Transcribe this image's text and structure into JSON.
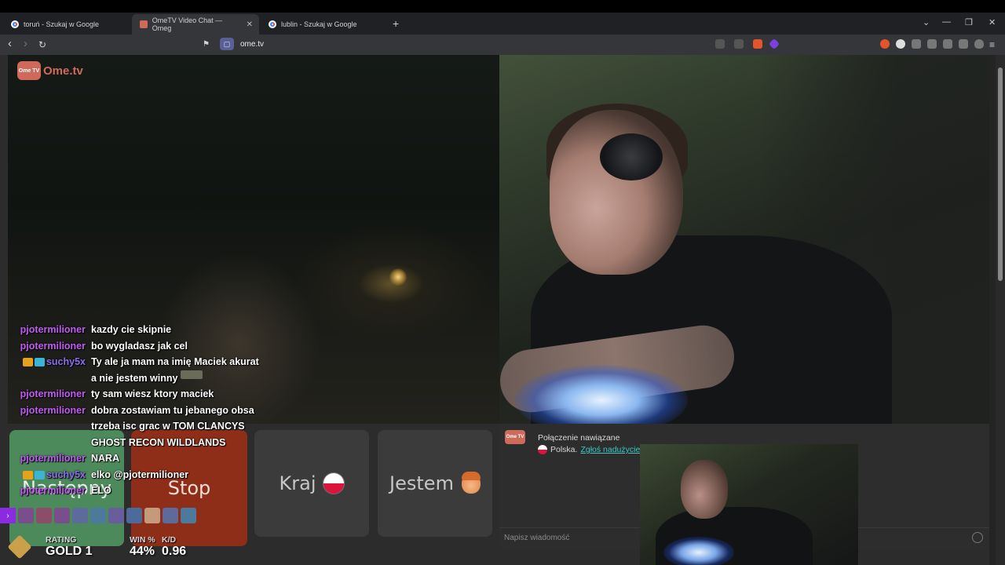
{
  "browser": {
    "tabs": [
      {
        "title": "toruń - Szukaj w Google"
      },
      {
        "title": "OmeTV Video Chat — Omeg"
      },
      {
        "title": "lublin - Szukaj w Google"
      }
    ],
    "url": "ome.tv",
    "new_tab": "+",
    "controls": {
      "dropdown": "⌄",
      "minimize": "—",
      "restore": "❐",
      "close": "✕"
    },
    "nav": {
      "back": "‹",
      "forward": "›",
      "reload": "↻",
      "bookmark": "⚑",
      "menu": "≡"
    }
  },
  "logo": {
    "mark": "Ome TV",
    "word": "Ome.tv"
  },
  "chat_overlay": [
    {
      "user": "pjotermilioner",
      "text": "kazdy cie skipnie"
    },
    {
      "user": "pjotermilioner",
      "text": "bo wygladasz jak cel"
    },
    {
      "user": "suchy5x",
      "text": "Ty ale ja mam na imię Maciek akurat"
    },
    {
      "user": "",
      "text": "a nie jestem winny"
    },
    {
      "user": "pjotermilioner",
      "text": "ty sam wiesz ktory maciek"
    },
    {
      "user": "pjotermilioner",
      "text": "dobra zostawiam tu jebanego obsa"
    },
    {
      "user": "",
      "text": "trzeba isc grac w TOM CLANCYS"
    },
    {
      "user": "",
      "text": "GHOST RECON WILDLANDS"
    },
    {
      "user": "pjotermilioner",
      "text": "NARA"
    },
    {
      "user": "suchy5x",
      "text": "elko @pjotermilioner"
    },
    {
      "user": "pjotermilioner",
      "text": "ELO"
    }
  ],
  "buttons": {
    "next": "Następny",
    "stop": "Stop",
    "country": "Kraj",
    "iam": "Jestem"
  },
  "system": {
    "logo": "Ome TV",
    "connected": "Połączenie nawiązane",
    "country": "Polska.",
    "report": "Zgłoś nadużycie",
    "report_suffix": "."
  },
  "message_input": {
    "placeholder": "Napisz wiadomość"
  },
  "hud": {
    "rating_label": "RATING",
    "rating_value": "GOLD 1",
    "win_label": "WIN %",
    "kd_label": "K/D",
    "win_value": "44%",
    "kd_value": "0.96",
    "strip_arrow": "›"
  },
  "colors": {
    "next": "#4c8a5c",
    "stop": "#8e2d18",
    "neutral_button": "#3b3b3b",
    "username": "#c25bf5",
    "brand": "#cf6a5a",
    "link": "#3ec7c3"
  }
}
